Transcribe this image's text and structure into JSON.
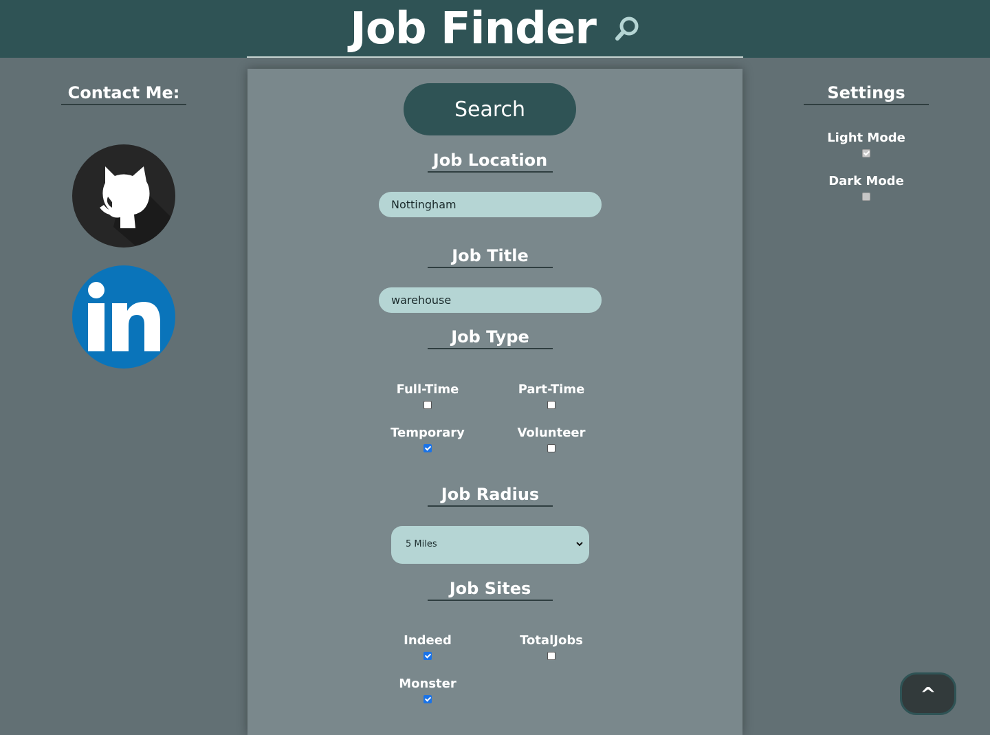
{
  "header": {
    "title": "Job Finder",
    "icon": "search-icon"
  },
  "contact": {
    "title": "Contact Me:",
    "links": [
      {
        "name": "github",
        "icon": "github-icon"
      },
      {
        "name": "linkedin",
        "icon": "linkedin-icon"
      }
    ]
  },
  "settings": {
    "title": "Settings",
    "options": [
      {
        "label": "Light Mode",
        "checked": true,
        "disabled": true
      },
      {
        "label": "Dark Mode",
        "checked": false,
        "disabled": true
      }
    ]
  },
  "form": {
    "search_label": "Search",
    "location": {
      "title": "Job Location",
      "value": "Nottingham"
    },
    "job_title": {
      "title": "Job Title",
      "value": "warehouse"
    },
    "job_type": {
      "title": "Job Type",
      "options": [
        {
          "label": "Full-Time",
          "checked": false
        },
        {
          "label": "Part-Time",
          "checked": false
        },
        {
          "label": "Temporary",
          "checked": true
        },
        {
          "label": "Volunteer",
          "checked": false
        }
      ]
    },
    "radius": {
      "title": "Job Radius",
      "selected": "5 Miles"
    },
    "sites": {
      "title": "Job Sites",
      "options": [
        {
          "label": "Indeed",
          "checked": true
        },
        {
          "label": "TotalJobs",
          "checked": false
        },
        {
          "label": "Monster",
          "checked": true
        }
      ]
    }
  },
  "back_to_top": {
    "label": "^"
  },
  "colors": {
    "header_bg": "#2f5355",
    "page_bg": "#627074",
    "panel_bg": "#7a888c",
    "input_bg": "#b5d5d4",
    "accent_check": "#1a73e8"
  }
}
